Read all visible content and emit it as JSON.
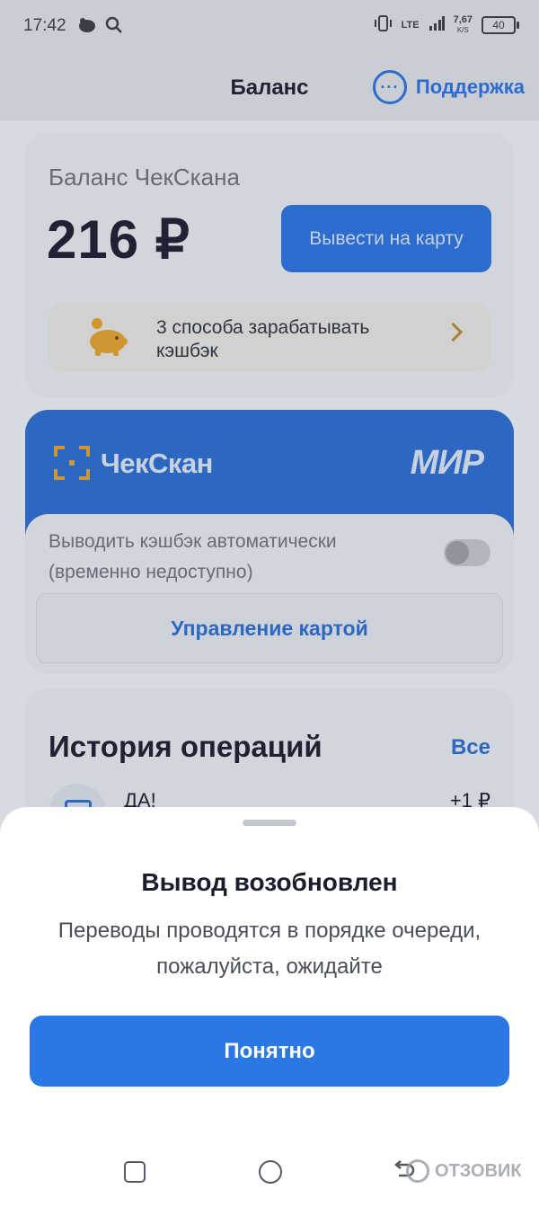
{
  "status_bar": {
    "time": "17:42",
    "network": "LTE",
    "speed_value": "7,67",
    "speed_unit": "K/S",
    "battery": "40"
  },
  "header": {
    "title": "Баланс",
    "support_label": "Поддержка"
  },
  "balance": {
    "label": "Баланс ЧекСкана",
    "value": "216 ₽",
    "withdraw_label": "Вывести на карту",
    "cashback_ways_line1": "3 способа зарабатывать",
    "cashback_ways_line2": "кэшбэк"
  },
  "card": {
    "brand": "ЧекСкан",
    "payment_system": "МИР",
    "auto_line1": "Выводить кэшбэк автоматически",
    "auto_line2": "(временно недоступно)",
    "auto_enabled": false,
    "manage_label": "Управление картой"
  },
  "history": {
    "title": "История операций",
    "all_label": "Все",
    "items": [
      {
        "name": "ДА!",
        "amount": "+1 ₽"
      }
    ]
  },
  "sheet": {
    "title": "Вывод возобновлен",
    "message_line1": "Переводы проводятся в порядке очереди,",
    "message_line2": "пожалуйста, ожидайте",
    "ok_label": "Понятно"
  },
  "watermark": "ОТЗОВИК",
  "colors": {
    "accent": "#2b73e0",
    "card_blue": "#2b6ed2",
    "coin_gold": "#e8a52a"
  }
}
